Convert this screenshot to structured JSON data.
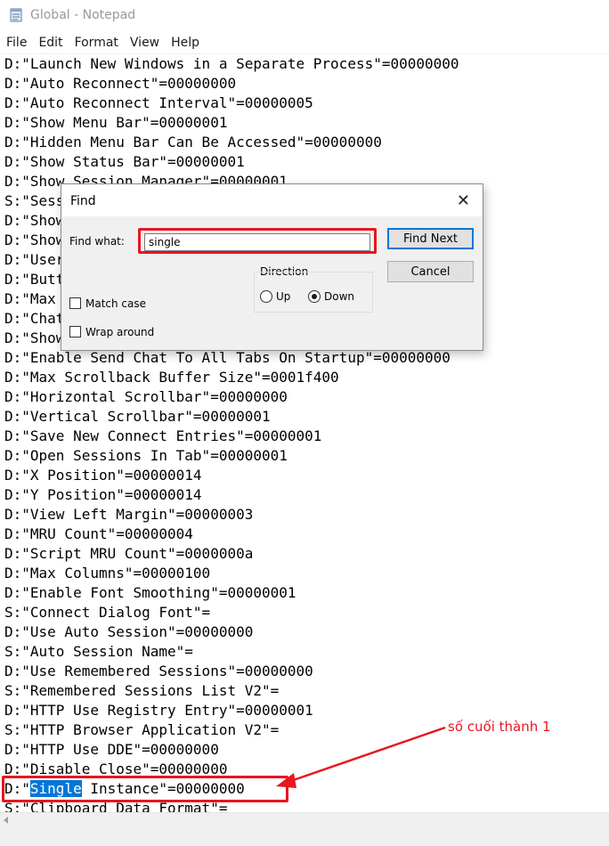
{
  "window": {
    "title": "Global - Notepad",
    "icon": "notepad-icon"
  },
  "menu": [
    "File",
    "Edit",
    "Format",
    "View",
    "Help"
  ],
  "editor": {
    "lines": [
      "D:\"Launch New Windows in a Separate Process\"=00000000",
      "D:\"Auto Reconnect\"=00000000",
      "D:\"Auto Reconnect Interval\"=00000005",
      "D:\"Show Menu Bar\"=00000001",
      "D:\"Hidden Menu Bar Can Be Accessed\"=00000000",
      "D:\"Show Status Bar\"=00000001",
      "D:\"Show Session Manager\"=00000001",
      "S:\"Sess",
      "D:\"Show",
      "D:\"Show",
      "D:\"User",
      "D:\"Butt",
      "D:\"Max ",
      "D:\"Chat",
      "D:\"Show",
      "D:\"Enable Send Chat To All Tabs On Startup\"=00000000",
      "D:\"Max Scrollback Buffer Size\"=0001f400",
      "D:\"Horizontal Scrollbar\"=00000000",
      "D:\"Vertical Scrollbar\"=00000001",
      "D:\"Save New Connect Entries\"=00000001",
      "D:\"Open Sessions In Tab\"=00000001",
      "D:\"X Position\"=00000014",
      "D:\"Y Position\"=00000014",
      "D:\"View Left Margin\"=00000003",
      "D:\"MRU Count\"=00000004",
      "D:\"Script MRU Count\"=0000000a",
      "D:\"Max Columns\"=00000100",
      "D:\"Enable Font Smoothing\"=00000001",
      "S:\"Connect Dialog Font\"=",
      "D:\"Use Auto Session\"=00000000",
      "S:\"Auto Session Name\"=",
      "D:\"Use Remembered Sessions\"=00000000",
      "S:\"Remembered Sessions List V2\"=",
      "D:\"HTTP Use Registry Entry\"=00000001",
      "S:\"HTTP Browser Application V2\"=",
      "D:\"HTTP Use DDE\"=00000000",
      "D:\"Disable Close\"=00000000"
    ],
    "selected_line": {
      "prefix": "D:\"",
      "selected": "Single",
      "suffix": " Instance\"=00000000"
    },
    "last_line": "S:\"Clipboard Data Format\"="
  },
  "find_dialog": {
    "title": "Find",
    "find_what_label": "Find what:",
    "find_what_value": "single",
    "find_next_label": "Find Next",
    "cancel_label": "Cancel",
    "direction_label": "Direction",
    "up_label": "Up",
    "down_label": "Down",
    "direction_selected": "Down",
    "match_case_label": "Match case",
    "match_case_checked": false,
    "wrap_around_label": "Wrap around",
    "wrap_around_checked": false
  },
  "annotation": {
    "text": "số cuối thành 1",
    "color": "#e8161e"
  },
  "colors": {
    "selection": "#0078d7",
    "highlight_box": "#e8161e",
    "default_button_border": "#0078d7"
  }
}
